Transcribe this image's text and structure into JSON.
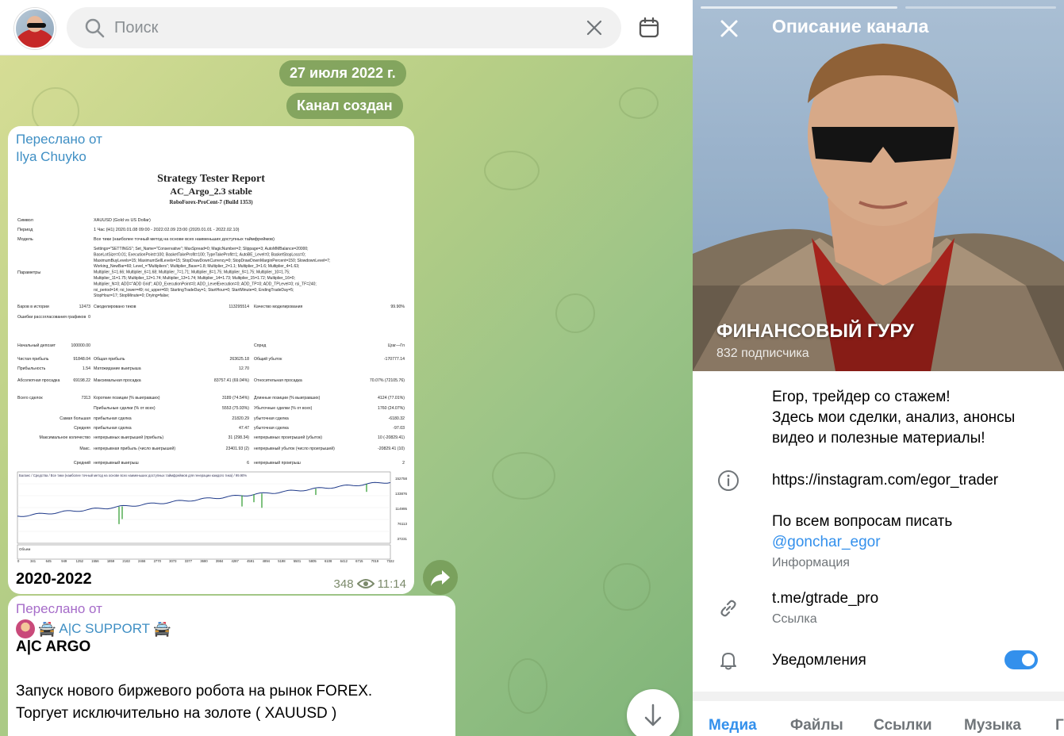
{
  "search": {
    "placeholder": "Поиск"
  },
  "chat": {
    "date_pill": "27 июля 2022 г.",
    "service_pill": "Канал создан",
    "message1": {
      "forwarded_label": "Переслано от",
      "forwarded_from": "Ilya Chuyko",
      "caption": "2020-2022",
      "views": "348",
      "time": "11:14",
      "report": {
        "title": "Strategy Tester Report",
        "subtitle": "AC_Argo_2.3 stable",
        "build": "RoboForex-ProCent-7 (Build 1353)",
        "symbol_label": "Символ",
        "symbol_value": "XAUUSD (Gold vs US Dollar)",
        "period_label": "Период",
        "period_value": "1 Час (H1) 2020.01.08 09:00 - 2022.02.09 23:00 (2020.01.01 - 2022.02.10)",
        "model_label": "Модель",
        "model_value": "Все тики (наиболее точный метод на основе всех наименьших доступных таймфреймов)",
        "params_label": "Параметры",
        "params_value": "Settings=\"SETTINGS\"; Set_Name=\"Conservative\"; MaxSpread=0; MagicNumber=2; Slippage=3; AutoMMBalance=20000; BaseLotSize=0.01; ExecutionPoint=100; BasketTakeProfit=100; TypeTakeProfit=1; AutoBE_Level=0; BasketStopLoss=0; MaximumBuyLevels=15; MaximumSellLevels=15; StopDrawDownCurrency=0; StopDrawDownMarginPercent=150; SlowdownLevel=7; Working_NewBar=60; Level_=\"Multipliers\"; Multiplier_Base=1.8; Multiplier_2=1.1; Multiplier_3=1.6; Multiplier_4=1.63; Multiplier_5=1.66; Multiplier_6=1.68; Multiplier_7=1.71; Multiplier_8=1.75; Multiplier_9=1.75; Multiplier_10=1.75; Multiplier_11=1.75; Multiplier_12=1.74; Multiplier_13=1.74; Multiplier_14=1.73; Multiplier_15=1.72; Multiplier_16=0; Multiplier_N=0; ADD=\"ADD Grid\"; ADD_ExecutionPoint=0; ADD_LevelExecution=0; ADD_TP=0; ADD_TPLevel=0; rsi_TF=240; rsi_period=14; rsi_lower=49; rsi_upper=60; StartingTradeDay=1; StartHour=0; StartMinute=0; EndingTradeDay=5; StopHour=17; StopMinute=0; Drying=false;",
        "rows": [
          [
            "Баров в истории",
            "12473",
            "Смоделировано тиков",
            "113295514",
            "Качество моделирования",
            "99.90%"
          ],
          [
            "Ошибки рассогласования графиков",
            "0",
            "",
            "",
            "",
            ""
          ],
          [
            "Начальный депозит",
            "100000.00",
            "",
            "",
            "Спред",
            "Цгаг—Гп"
          ],
          [
            "Чистая прибыль",
            "91848.04",
            "Общая прибыль",
            "263625.18",
            "Общий убыток",
            "-170777.14"
          ],
          [
            "Прибыльность",
            "1.54",
            "Матожидание выигрыша",
            "12.70",
            "",
            ""
          ],
          [
            "Абсолютная просадка",
            "69198.22",
            "Максимальная просадка",
            "83757.41 (69.04%)",
            "Относительная просадка",
            "70.07% (72105.76)"
          ],
          [
            "Всего сделок",
            "7313",
            "Короткие позиции (% выигравших)",
            "3189 (74.54%)",
            "Длинные позиции (% выигравших)",
            "4124 (77.01%)"
          ],
          [
            "",
            "",
            "Прибыльные сделки (% от всех)",
            "5553 (75.93%)",
            "Убыточные сделки (% от всех)",
            "1760 (24.07%)"
          ],
          [
            "",
            "Самая большая",
            "прибыльная сделка",
            "21820.29",
            "убыточная сделка",
            "-6180.32"
          ],
          [
            "",
            "Средняя",
            "прибыльная сделка",
            "47.47",
            "убыточная сделка",
            "-97.03"
          ],
          [
            "",
            "Максимальное количество",
            "непрерывных выигрышей (прибыль)",
            "31 (298.34)",
            "непрерывных проигрышей (убыток)",
            "10 (-20829.41)"
          ],
          [
            "",
            "Макс.",
            "непрерывная прибыль (число выигрышей)",
            "23401.93 (2)",
            "непрерывный убыток (число проигрышей)",
            "-20829.41 (10)"
          ],
          [
            "",
            "Средний",
            "непрерывный выигрыш",
            "6",
            "непрерывный проигрыш",
            "2"
          ]
        ],
        "graph_header": "Баланс / Средства / Все тики (наиболее точный метод на основе всех наименьших доступных таймфреймов для генерации каждого тика) / 99.90%",
        "volume_label": "Объем",
        "y_ticks": [
          "152758",
          "133876",
          "114995",
          "76113",
          "37231"
        ],
        "x_ticks": [
          "0",
          "341",
          "645",
          "949",
          "1252",
          "1556",
          "1859",
          "2163",
          "2466",
          "2770",
          "3073",
          "3377",
          "3680",
          "3984",
          "4287",
          "4591",
          "4894",
          "5198",
          "5501",
          "5805",
          "6108",
          "6412",
          "6715",
          "7019",
          "7322"
        ]
      }
    },
    "message2": {
      "forwarded_label": "Переслано от",
      "forwarded_from": "A|C SUPPORT",
      "title": "A|C ARGO",
      "line1": "Запуск нового биржевого робота на рынок FOREX.",
      "line2": "Торгует исключительно на золоте ( XAUUSD )"
    }
  },
  "panel": {
    "title": "Описание канала",
    "channel_name": "ФИНАНСОВЫЙ ГУРУ",
    "subscribers": "832 подписчика",
    "description": [
      "Егор, трейдер со стажем!",
      "Здесь мои сделки, анализ, анонсы",
      "видео и полезные материалы!"
    ],
    "link_instagram": "https://instagram.com/egor_trader",
    "contact_line": "По всем вопросам писать",
    "contact_handle": "@gonchar_egor",
    "info_label": "Информация",
    "channel_link": "t.me/gtrade_pro",
    "channel_link_label": "Ссылка",
    "notifications_label": "Уведомления",
    "notifications_on": true,
    "tabs": [
      "Медиа",
      "Файлы",
      "Ссылки",
      "Музыка",
      "Г"
    ]
  },
  "colors": {
    "accent": "#3390ec",
    "forward_label": "#3f8fc4",
    "pill_bg": "#70964f"
  }
}
